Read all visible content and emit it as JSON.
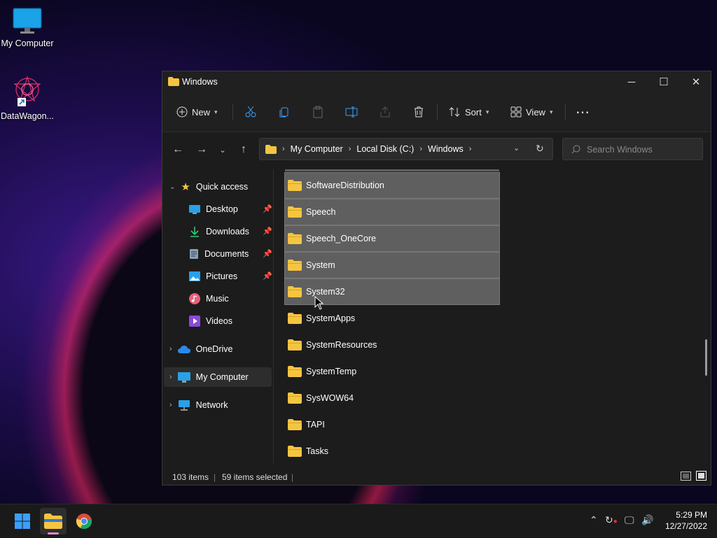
{
  "desktop": {
    "icons": [
      {
        "label": "My Computer"
      },
      {
        "label": "DataWagon..."
      }
    ]
  },
  "window": {
    "title": "Windows",
    "controls": {
      "minimize": "─",
      "maximize": "☐",
      "close": "✕"
    }
  },
  "toolbar": {
    "new_label": "New",
    "sort_label": "Sort",
    "view_label": "View",
    "more": "⋯"
  },
  "address": {
    "crumbs": [
      "My Computer",
      "Local Disk (C:)",
      "Windows"
    ]
  },
  "search": {
    "placeholder": "Search Windows"
  },
  "sidebar": {
    "quick_access": "Quick access",
    "items": [
      {
        "label": "Desktop",
        "pinned": true
      },
      {
        "label": "Downloads",
        "pinned": true
      },
      {
        "label": "Documents",
        "pinned": true
      },
      {
        "label": "Pictures",
        "pinned": true
      },
      {
        "label": "Music",
        "pinned": false
      },
      {
        "label": "Videos",
        "pinned": false
      }
    ],
    "onedrive": "OneDrive",
    "my_computer": "My Computer",
    "network": "Network"
  },
  "files": [
    {
      "name": "SoftwareDistribution",
      "selected": true
    },
    {
      "name": "Speech",
      "selected": true
    },
    {
      "name": "Speech_OneCore",
      "selected": true
    },
    {
      "name": "System",
      "selected": true
    },
    {
      "name": "System32",
      "selected": true
    },
    {
      "name": "SystemApps",
      "selected": false
    },
    {
      "name": "SystemResources",
      "selected": false
    },
    {
      "name": "SystemTemp",
      "selected": false
    },
    {
      "name": "SysWOW64",
      "selected": false
    },
    {
      "name": "TAPI",
      "selected": false
    },
    {
      "name": "Tasks",
      "selected": false
    }
  ],
  "status": {
    "item_count": "103 items",
    "selected_count": "59 items selected"
  },
  "taskbar": {
    "time": "5:29 PM",
    "date": "12/27/2022"
  },
  "colors": {
    "folder": "#f5c542",
    "selection": "#5f5f5f",
    "window_bg": "#1c1c1c",
    "accent": "#0078d4"
  }
}
